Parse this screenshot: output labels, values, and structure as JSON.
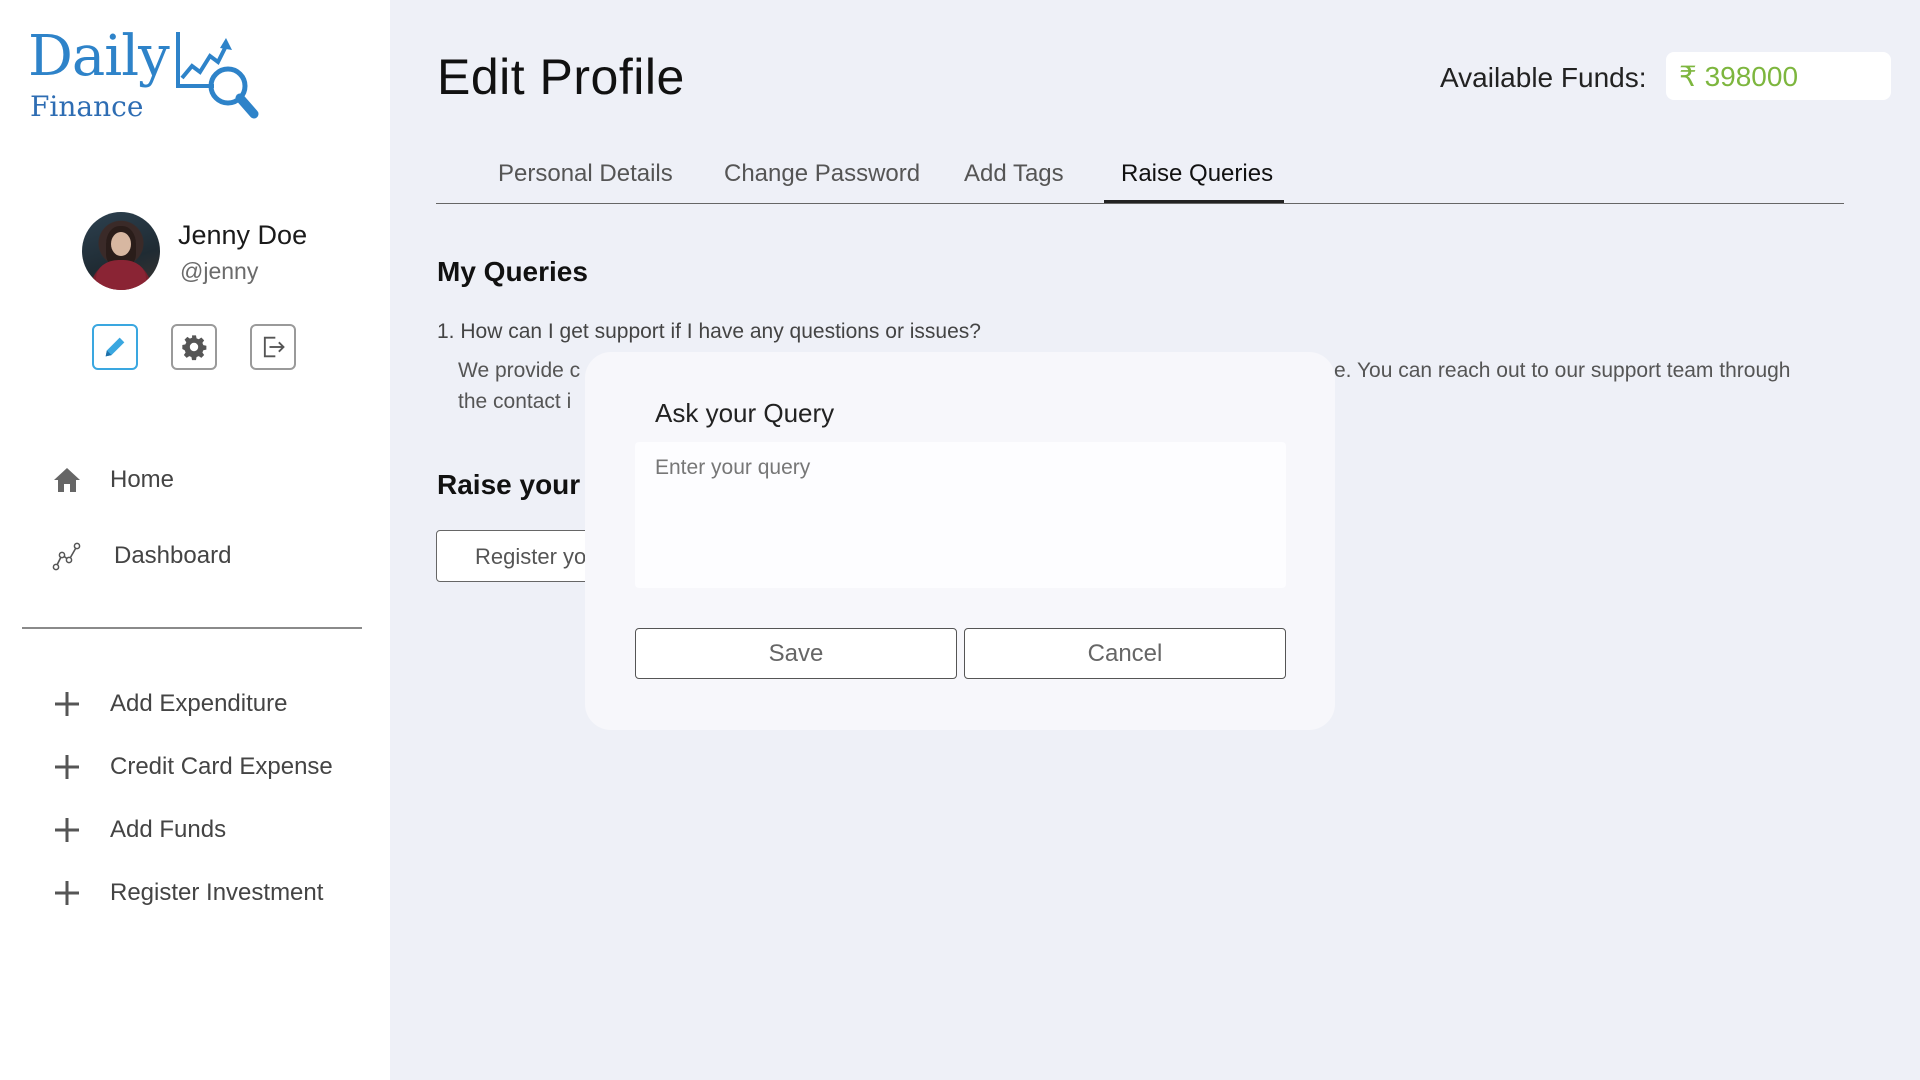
{
  "brand": {
    "line1": "Daily",
    "line2": "Finance"
  },
  "user": {
    "name": "Jenny Doe",
    "handle": "@jenny"
  },
  "sidebar": {
    "actions": [
      {
        "name": "edit-icon"
      },
      {
        "name": "gear-icon"
      },
      {
        "name": "logout-icon"
      }
    ],
    "nav": [
      {
        "label": "Home",
        "icon": "home-icon"
      },
      {
        "label": "Dashboard",
        "icon": "chart-line-icon"
      }
    ],
    "quick_actions": [
      {
        "label": "Add Expenditure",
        "icon": "plus-icon"
      },
      {
        "label": "Credit Card Expense",
        "icon": "plus-icon"
      },
      {
        "label": "Add Funds",
        "icon": "plus-icon"
      },
      {
        "label": "Register Investment",
        "icon": "plus-icon"
      }
    ]
  },
  "header": {
    "title": "Edit Profile",
    "funds_label": "Available Funds:",
    "funds_value": "₹ 398000"
  },
  "tabs": [
    {
      "label": "Personal Details"
    },
    {
      "label": "Change Password"
    },
    {
      "label": "Add Tags"
    },
    {
      "label": "Raise Queries",
      "active": true
    }
  ],
  "queries": {
    "title": "My Queries",
    "items": [
      {
        "question": "1. How can I get support if I have any questions or issues?",
        "answer_line1_start": "We provide c",
        "answer_line1_end": "e. You can reach out to our support team through",
        "answer_line2": "the contact i"
      }
    ]
  },
  "raise": {
    "title": "Raise your c",
    "button_label": "Register yo"
  },
  "modal": {
    "title": "Ask your Query",
    "input_value": "",
    "input_placeholder": "Enter your query",
    "save_label": "Save",
    "cancel_label": "Cancel"
  },
  "colors": {
    "brand_blue": "#2e83c9",
    "funds_green": "#7db63e",
    "active_edit": "#3aa7e0"
  }
}
